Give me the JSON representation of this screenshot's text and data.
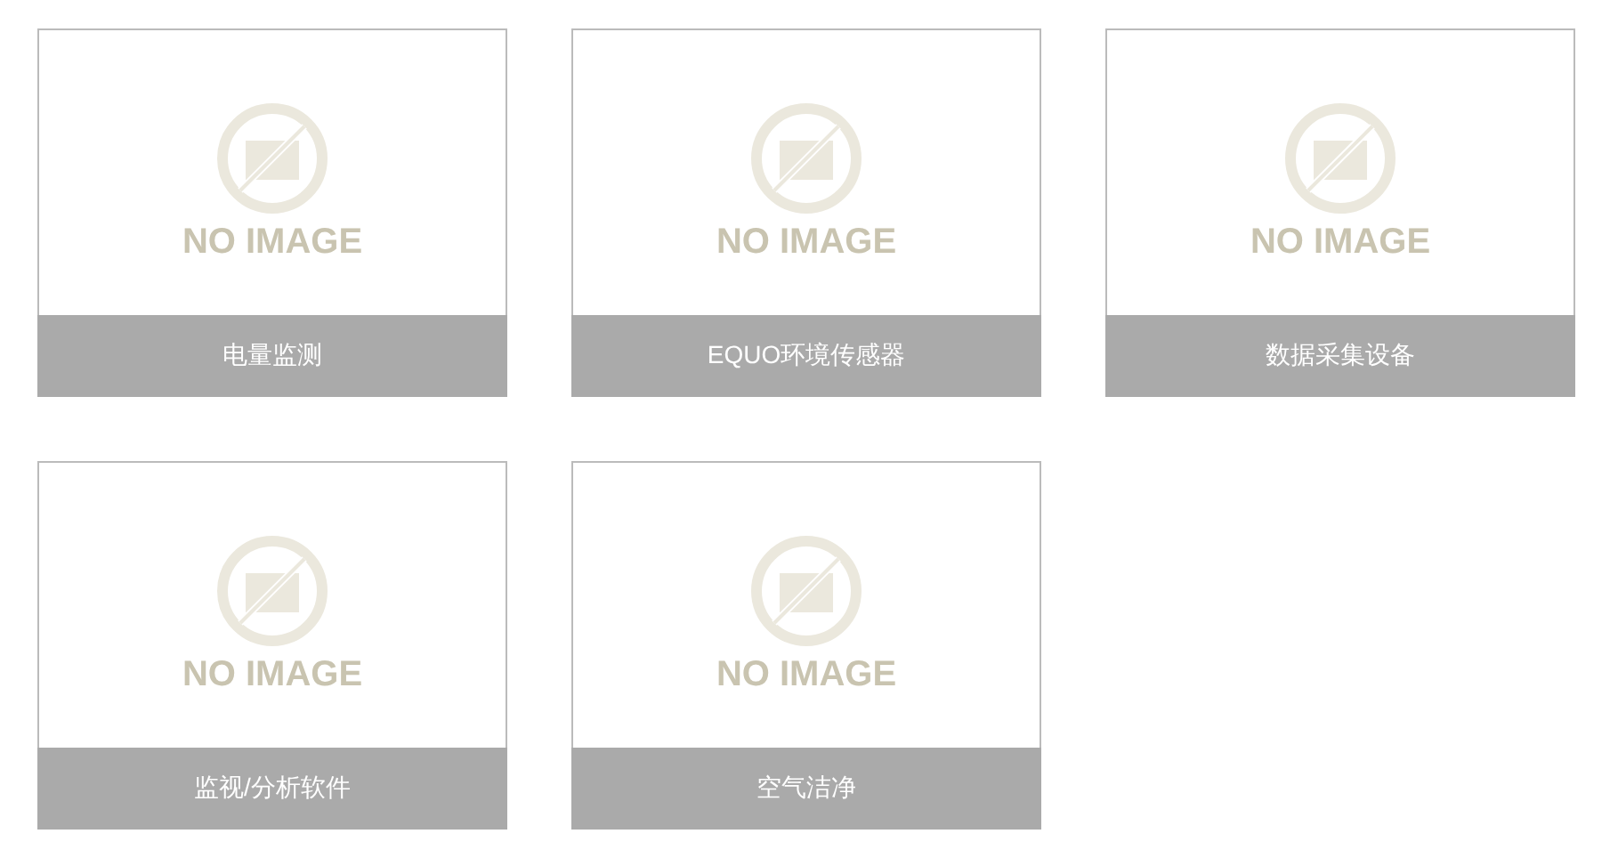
{
  "products": [
    {
      "placeholder_text": "NO IMAGE",
      "caption": "电量监测"
    },
    {
      "placeholder_text": "NO IMAGE",
      "caption": "EQUO环境传感器"
    },
    {
      "placeholder_text": "NO IMAGE",
      "caption": "数据采集设备"
    },
    {
      "placeholder_text": "NO IMAGE",
      "caption": "监视/分析软件"
    },
    {
      "placeholder_text": "NO IMAGE",
      "caption": "空气洁净"
    }
  ]
}
